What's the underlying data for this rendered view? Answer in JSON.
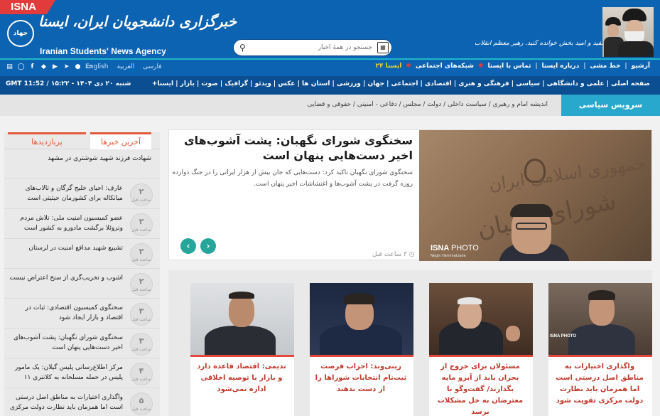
{
  "header": {
    "isna_tag": "ISNA",
    "emblem_label": "جهاد",
    "logo_fa": "خبرگزاری دانشجویان ایران، ایسنا",
    "logo_en": "Iranian Students' News Agency",
    "search_placeholder": "جستجو در همهٔ اخبار",
    "slogan": "اخبار خوب، مفید و امید بخش خوانده کنید.  رهبر معظم انقلاب"
  },
  "topnav": {
    "links": [
      "آرشیو",
      "خط مشی",
      "درباره ایسنا",
      "تماس با ایسنا",
      "شبکه‌های اجتماعی",
      "ایسنا ۲۴"
    ],
    "languages": [
      "فارسی",
      "العربية",
      "English"
    ],
    "social_icons": [
      "rss-icon",
      "instagram-icon",
      "facebook-icon",
      "twitter-icon",
      "youtube-icon",
      "telegram-icon",
      "aparat-icon",
      "tv-icon"
    ]
  },
  "catbar": {
    "datetime": "GMT 11:52  /  شنبه ۲۰ دی ۱۴۰۴ - ۱۵:۲۲",
    "categories": "صفحه اصلی | علمی و دانشگاهی | سیاسی | فرهنگی و هنری | اقتصادی | اجتماعی | جهان | ورزشی | استان ها | عکس | ویدئو | گرافیک | صوت | بازار | ایسنا+"
  },
  "servicebar": {
    "title": "سرویس سیاسی",
    "links": "اندیشه امام و رهبری   /   سیاست داخلی   /   دولت   /   مجلس   /   دفاعی - امنیتی   /   حقوقی و قضایی"
  },
  "sidebar": {
    "tab_latest": "آخرین خبرها",
    "tab_popular": "پربازدیدها",
    "items": [
      {
        "title": "شهادت فرزند شهید شوشتری در مشهد",
        "badge": "",
        "unit": ""
      },
      {
        "title": "عارف: احیای خلیج گرگان و تالاب‌های میانکاله برای کشورمان حیثیتی است",
        "badge": "۲",
        "unit": "ساعت قبل"
      },
      {
        "title": "عضو کمیسیون امنیت ملی: تلاش مردم ونزوئلا برگشت مادورو به کشور است",
        "badge": "۲",
        "unit": "ساعت قبل"
      },
      {
        "title": "تشییع شهید مدافع امنیت در لرستان",
        "badge": "۲",
        "unit": "ساعت قبل"
      },
      {
        "title": "اشوب و تخریب‌گری از سنخ اعتراض نیست",
        "badge": "۲",
        "unit": "ساعت قبل"
      },
      {
        "title": "سخنگوی کمیسیون اقتصادی: ثبات در اقتصاد و بازار ایجاد شود",
        "badge": "۳",
        "unit": "ساعت قبل"
      },
      {
        "title": "سخنگوی شورای نگهبان: پشت آشوب‌های اخیر دست‌هایی پنهان است",
        "badge": "۳",
        "unit": "ساعت قبل"
      },
      {
        "title": "مرکز اطلاع‌رسانی پلیس گیلان: یک مامور پلیس در حمله مسلحانه به کلانتری ۱۱ رودبار شهید شد",
        "badge": "۴",
        "unit": "ساعت قبل"
      },
      {
        "title": "واگذاری اختیارات به مناطق اصل درستی است اما همزمان باید نظارت دولت مرکزی",
        "badge": "۵",
        "unit": "ساعت قبل"
      }
    ]
  },
  "featured": {
    "title": "سخنگوی شورای نگهبان: پشت آشوب‌های اخیر دست‌هایی پنهان است",
    "summary": "سخنگوی شورای نگهبان تاکید کرد: دست‌هایی که جان بیش از هزار ایرانی را در جنگ دوازده روزه گرفت در پشت آشوب‌ها و اغتشاشات اخیر پنهان است.",
    "time": "۳ ساعت قبل",
    "photo_wall_text": "جمهوری اسلامی ایران",
    "photo_wall_text2": "شورای نگهبان",
    "watermark_bold": "ISNA",
    "watermark_light": "PHOTO",
    "watermark_credit": "Negin Hemmatzade"
  },
  "cards": [
    {
      "title": "واگذاری اختیارات به مناطق اصل درستی است اما همزمان باید نظارت دولت مرکزی تقویت شود",
      "tag": "ISNA PHOTO"
    },
    {
      "title": "مسئولان برای خروج از بحران باید از آبرو مایه بگذارند/ گفت‌وگو با معترضان به حل مشکلات برسد",
      "tag": ""
    },
    {
      "title": "زینی‌وند: احزاب فرصت ثبت‌نام انتخابات شوراها را از دست ندهند",
      "tag": ""
    },
    {
      "title": "ندیمی: اقتصاد قاعده دارد و بازار با توصیه اخلاقی اداره نمی‌شود",
      "tag": ""
    }
  ],
  "colors": {
    "header_blue": "#0c63b2",
    "nav_dark_blue": "#0b4e91",
    "service_teal": "#27a8cc",
    "accent_red": "#e2483b",
    "arrow_teal": "#26a69a"
  }
}
